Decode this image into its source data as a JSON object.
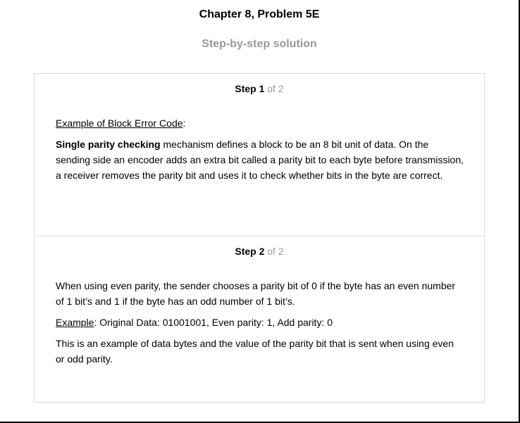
{
  "header": {
    "title": "Chapter 8, Problem 5E",
    "subtitle": "Step-by-step solution"
  },
  "steps": [
    {
      "label": "Step 1",
      "of": "of 2",
      "heading": "Example of Block Error Code",
      "heading_suffix": ":",
      "bold_term": "Single parity checking",
      "paragraph_rest": " mechanism defines a block to be an 8 bit unit of data. On the sending side an encoder adds an extra bit called a parity bit to each byte before transmission, a receiver removes the parity bit and uses it to check whether bits in the byte are correct."
    },
    {
      "label": "Step 2",
      "of": "of 2",
      "paragraph1": "When using even parity, the sender chooses a parity bit of 0 if the byte has an even number of 1 bit’s and 1 if the byte has an odd number of 1 bit’s.",
      "example_label": "Example",
      "example_rest": ": Original Data: 01001001, Even parity: 1, Add parity: 0",
      "paragraph3": "This is an example of data bytes and the value of the parity bit that is sent when using even or odd parity."
    }
  ]
}
